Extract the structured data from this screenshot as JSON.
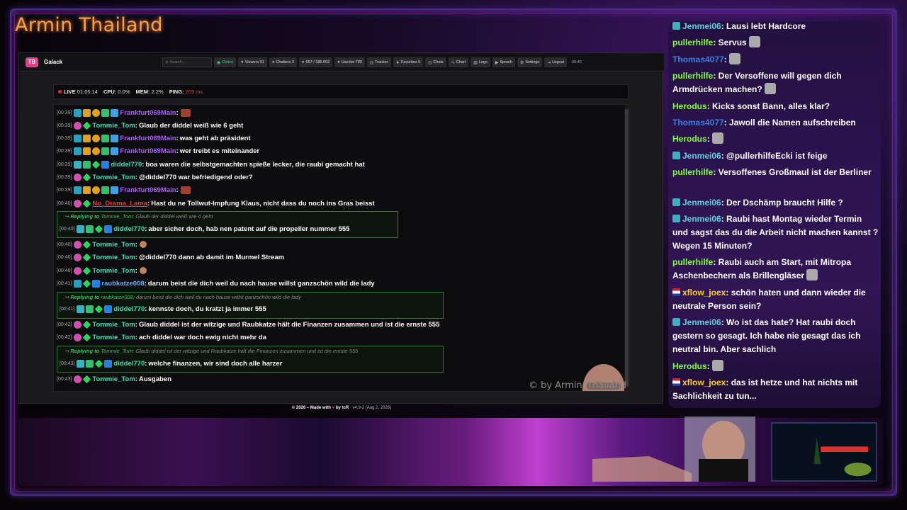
{
  "stream": {
    "title": "Armin Thailand",
    "watermark": "© by Armin_Thailand"
  },
  "app": {
    "logo": "TB",
    "name": "Galack",
    "search_placeholder": "Search...",
    "nav": [
      {
        "label": "Online",
        "icon": "online-icon"
      },
      {
        "label": "Viewers 91",
        "icon": "eye-icon"
      },
      {
        "label": "Chatters 3",
        "icon": "users-icon"
      },
      {
        "label": "557 / 185.602",
        "icon": "chat-icon"
      },
      {
        "label": "Userlist 789",
        "icon": "user-icon"
      },
      {
        "label": "Tracker",
        "icon": "tracker-icon"
      },
      {
        "label": "Favorites 0",
        "icon": "star-icon"
      },
      {
        "label": "Chats",
        "icon": "clock-icon"
      },
      {
        "label": "Chart",
        "icon": "chart-icon"
      },
      {
        "label": "Logs",
        "icon": "doc-icon"
      },
      {
        "label": "Spruch",
        "icon": "quote-icon"
      },
      {
        "label": "Settings",
        "icon": "gear-icon"
      },
      {
        "label": "Logout",
        "icon": "logout-icon"
      }
    ],
    "clock": "00:46",
    "status": {
      "live_label": "LIVE",
      "live_value": "01:05:14",
      "cpu_label": "CPU:",
      "cpu_value": "0.0%",
      "mem_label": "MEM:",
      "mem_value": "2.2%",
      "ping_label": "PING:",
      "ping_value": "209 ms"
    },
    "footer": {
      "copy": "© 2026 – Made with",
      "by": "by tcR",
      "version": "· v4.9-2 (Aug 2, 2026)"
    }
  },
  "chat_messages": [
    {
      "time": "[00:39]",
      "badges": [
        "sub",
        "crown",
        "coin",
        "bits",
        "vip"
      ],
      "nick": "Frankfurt069Main",
      "color": "#b05cff",
      "text": "",
      "emote": true
    },
    {
      "time": "[00:39]",
      "badges": [
        "pink",
        "green"
      ],
      "nick": "Tommie_Tom",
      "color": "#3fe0b0",
      "text": "Glaub der diddel weiß wie 6 geht"
    },
    {
      "time": "[00:39]",
      "badges": [
        "sub",
        "crown",
        "coin",
        "bits",
        "vip"
      ],
      "nick": "Frankfurt069Main",
      "color": "#b05cff",
      "text": "was geht ab präsident"
    },
    {
      "time": "[00:39]",
      "badges": [
        "sub",
        "crown",
        "coin",
        "bits",
        "vip"
      ],
      "nick": "Frankfurt069Main",
      "color": "#b05cff",
      "text": "wer treibt es miteinander"
    },
    {
      "time": "[00:39]",
      "badges": [
        "teal",
        "green2",
        "green",
        "gift"
      ],
      "nick": "diddel770",
      "color": "#3fe0b0",
      "text": "boa waren die selbstgemachten spieße lecker, die raubi gemacht hat"
    },
    {
      "time": "[00:39]",
      "badges": [
        "pink",
        "green"
      ],
      "nick": "Tommie_Tom",
      "color": "#3fe0b0",
      "text": "@diddel770 war befriedigend oder?"
    },
    {
      "time": "[00:39]",
      "badges": [
        "sub",
        "crown",
        "coin",
        "bits",
        "vip"
      ],
      "nick": "Frankfurt069Main",
      "color": "#b05cff",
      "text": "",
      "emote": true
    },
    {
      "time": "[00:40]",
      "badges": [
        "pink",
        "green"
      ],
      "nick": "No_Drama_Lama",
      "color": "#ff3030",
      "text": "Hast du ne Tollwut-Impfung Klaus, nicht dass du noch ins Gras beisst"
    },
    {
      "time": "[00:40]",
      "badges": [
        "teal",
        "green2",
        "green",
        "gift"
      ],
      "nick": "diddel770",
      "color": "#3fe0b0",
      "text": "aber sicher doch, hab nen patent auf die propeller nummer 555",
      "reply": {
        "to": "Tommie_Tom:",
        "quote": "Glaub der diddel weiß wie 6 geht"
      }
    },
    {
      "time": "[00:40]",
      "badges": [
        "pink",
        "green"
      ],
      "nick": "Tommie_Tom",
      "color": "#3fe0b0",
      "text": "",
      "emote": true
    },
    {
      "time": "[00:40]",
      "badges": [
        "pink",
        "green"
      ],
      "nick": "Tommie_Tom",
      "color": "#3fe0b0",
      "text": "@diddel770 dann ab damit im Murmel Stream"
    },
    {
      "time": "[00:40]",
      "badges": [
        "pink",
        "green"
      ],
      "nick": "Tommie_Tom",
      "color": "#3fe0b0",
      "text": "",
      "emote": true
    },
    {
      "time": "[00:41]",
      "badges": [
        "sub",
        "green",
        "gift"
      ],
      "nick": "raubkatze008",
      "color": "#6ab0ff",
      "text": "darum beist die dich weil du nach hause willst ganzschön wild die lady"
    },
    {
      "time": "[00:41]",
      "badges": [
        "teal",
        "green2",
        "green",
        "gift"
      ],
      "nick": "diddel770",
      "color": "#3fe0b0",
      "text": "kennste doch, du kratzt ja immer 555",
      "reply": {
        "to": "raubkatze008:",
        "quote": "darum beist die dich weil du nach hause willst ganzschön wild die lady"
      }
    },
    {
      "time": "[00:42]",
      "badges": [
        "pink",
        "green"
      ],
      "nick": "Tommie_Tom",
      "color": "#3fe0b0",
      "text": "Glaub diddel ist der witzige und Raubkatze hält die Finanzen zusammen und ist die ernste 555"
    },
    {
      "time": "[00:42]",
      "badges": [
        "pink",
        "green"
      ],
      "nick": "Tommie_Tom",
      "color": "#3fe0b0",
      "text": "ach diddel war doch ewig nicht mehr da"
    },
    {
      "time": "[00:43]",
      "badges": [
        "teal",
        "green2",
        "green",
        "gift"
      ],
      "nick": "diddel770",
      "color": "#3fe0b0",
      "text": "welche finanzen, wir sind doch alle harzer",
      "reply": {
        "to": "Tommie_Tom:",
        "quote": "Glaub diddel ist der witzige und Raubkatze hält die Finanzen zusammen und ist die ernste 555"
      }
    },
    {
      "time": "[00:43]",
      "badges": [
        "pink",
        "green"
      ],
      "nick": "Tommie_Tom",
      "color": "#3fe0b0",
      "text": "Ausgaben"
    }
  ],
  "reply_prefix": "Replying to",
  "side_chat": [
    {
      "icon": "sq",
      "nick": "Jenmei06",
      "color": "#60d0e0",
      "text": ": Lausi lebt Hardcore"
    },
    {
      "icon": "",
      "nick": "pullerhilfe",
      "color": "#80ff40",
      "text": ": Servus",
      "emote": true
    },
    {
      "icon": "",
      "nick": "Thomas4077",
      "color": "#3a80e0",
      "text": ":",
      "emote": true
    },
    {
      "icon": "",
      "nick": "pullerhilfe",
      "color": "#80ff40",
      "text": ": Der Versoffene will gegen dich Armdrücken machen?",
      "emote": true
    },
    {
      "icon": "",
      "nick": "Herodus",
      "color": "#80ff40",
      "text": ": Kicks sonst Bann, alles klar?"
    },
    {
      "icon": "",
      "nick": "Thomas4077",
      "color": "#3a80e0",
      "text": ": Jawoll die Namen aufschreiben"
    },
    {
      "icon": "",
      "nick": "Herodus",
      "color": "#80ff40",
      "text": ":",
      "emote": true
    },
    {
      "icon": "sq",
      "nick": "Jenmei06",
      "color": "#60d0e0",
      "text": ": @pullerhilfeEcki ist feige"
    },
    {
      "icon": "",
      "nick": "pullerhilfe",
      "color": "#80ff40",
      "text": ": Versoffenes Großmaul ist der Berliner"
    },
    {
      "icon": "sq",
      "nick": "Jenmei06",
      "color": "#60d0e0",
      "text": ": Der Dschämp braucht Hilfe ?"
    },
    {
      "icon": "sq",
      "nick": "Jenmei06",
      "color": "#60d0e0",
      "text": ": Raubi hast Montag wieder Termin und sagst das du die Arbeit nicht machen kannst ? Wegen 15 Minuten?"
    },
    {
      "icon": "",
      "nick": "pullerhilfe",
      "color": "#80ff40",
      "text": ": Raubi auch am Start, mit Mitropa Aschenbechern als Brillengläser",
      "emote": true
    },
    {
      "icon": "flag",
      "nick": "xflow_joex",
      "color": "#ffd020",
      "text": ": schön haten und dann wieder die neutrale Person sein?"
    },
    {
      "icon": "sq",
      "nick": "Jenmei06",
      "color": "#60d0e0",
      "text": ": Wo ist das hate? Hat raubi doch gestern so gesagt. Ich habe nie gesagt das ich neutral bin. Aber sachlich"
    },
    {
      "icon": "",
      "nick": "Herodus",
      "color": "#80ff40",
      "text": ":",
      "emote": true
    },
    {
      "icon": "flag",
      "nick": "xflow_joex",
      "color": "#ffd020",
      "text": ": das ist hetze und hat nichts mit Sachlichkeit zu tun..."
    }
  ]
}
